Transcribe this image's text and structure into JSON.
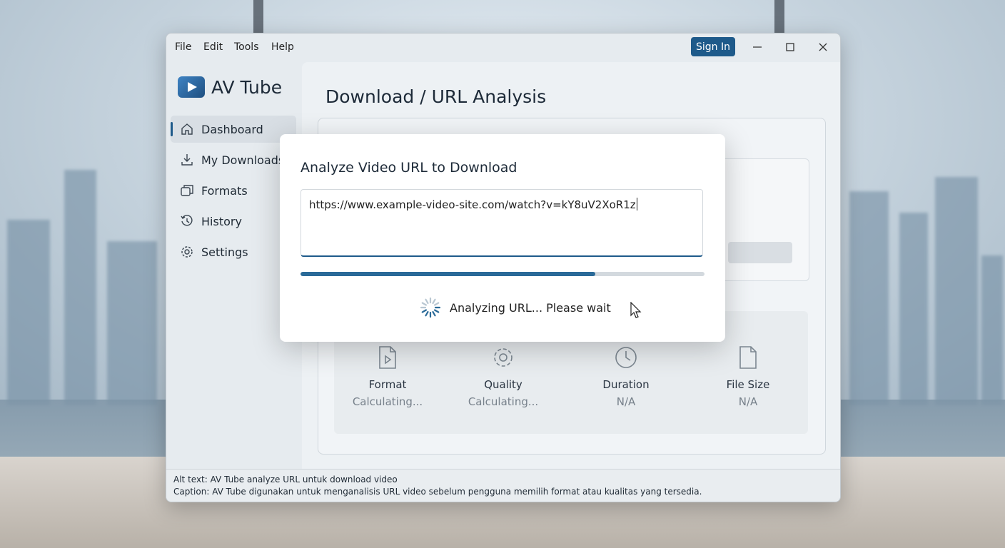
{
  "menu": {
    "items": [
      "File",
      "Edit",
      "Tools",
      "Help"
    ],
    "sign_in": "Sign In"
  },
  "app": {
    "name": "AV Tube"
  },
  "sidebar": {
    "items": [
      {
        "label": "Dashboard",
        "icon": "home-icon",
        "active": true
      },
      {
        "label": "My Downloads",
        "icon": "download-icon"
      },
      {
        "label": "Formats",
        "icon": "formats-icon"
      },
      {
        "label": "History",
        "icon": "history-icon"
      },
      {
        "label": "Settings",
        "icon": "gear-icon"
      }
    ]
  },
  "main": {
    "title": "Download / URL Analysis",
    "stats": [
      {
        "label": "Format",
        "value": "Calculating...",
        "icon": "video-file-icon"
      },
      {
        "label": "Quality",
        "value": "Calculating...",
        "icon": "gear-icon"
      },
      {
        "label": "Duration",
        "value": "N/A",
        "icon": "clock-icon"
      },
      {
        "label": "File Size",
        "value": "N/A",
        "icon": "file-icon"
      }
    ]
  },
  "modal": {
    "title": "Analyze Video URL to Download",
    "url_value": "https://www.example-video-site.com/watch?v=kY8uV2XoR1z",
    "progress_percent": 73,
    "status": "Analyzing URL... Please wait"
  },
  "statusbar": {
    "alt": "Alt text: AV Tube analyze URL untuk download video",
    "caption": "Caption: AV Tube digunakan untuk menganalisis URL video sebelum pengguna memilih format atau kualitas yang tersedia."
  },
  "colors": {
    "accent": "#1e5a8a",
    "progress": "#2a6a98"
  }
}
